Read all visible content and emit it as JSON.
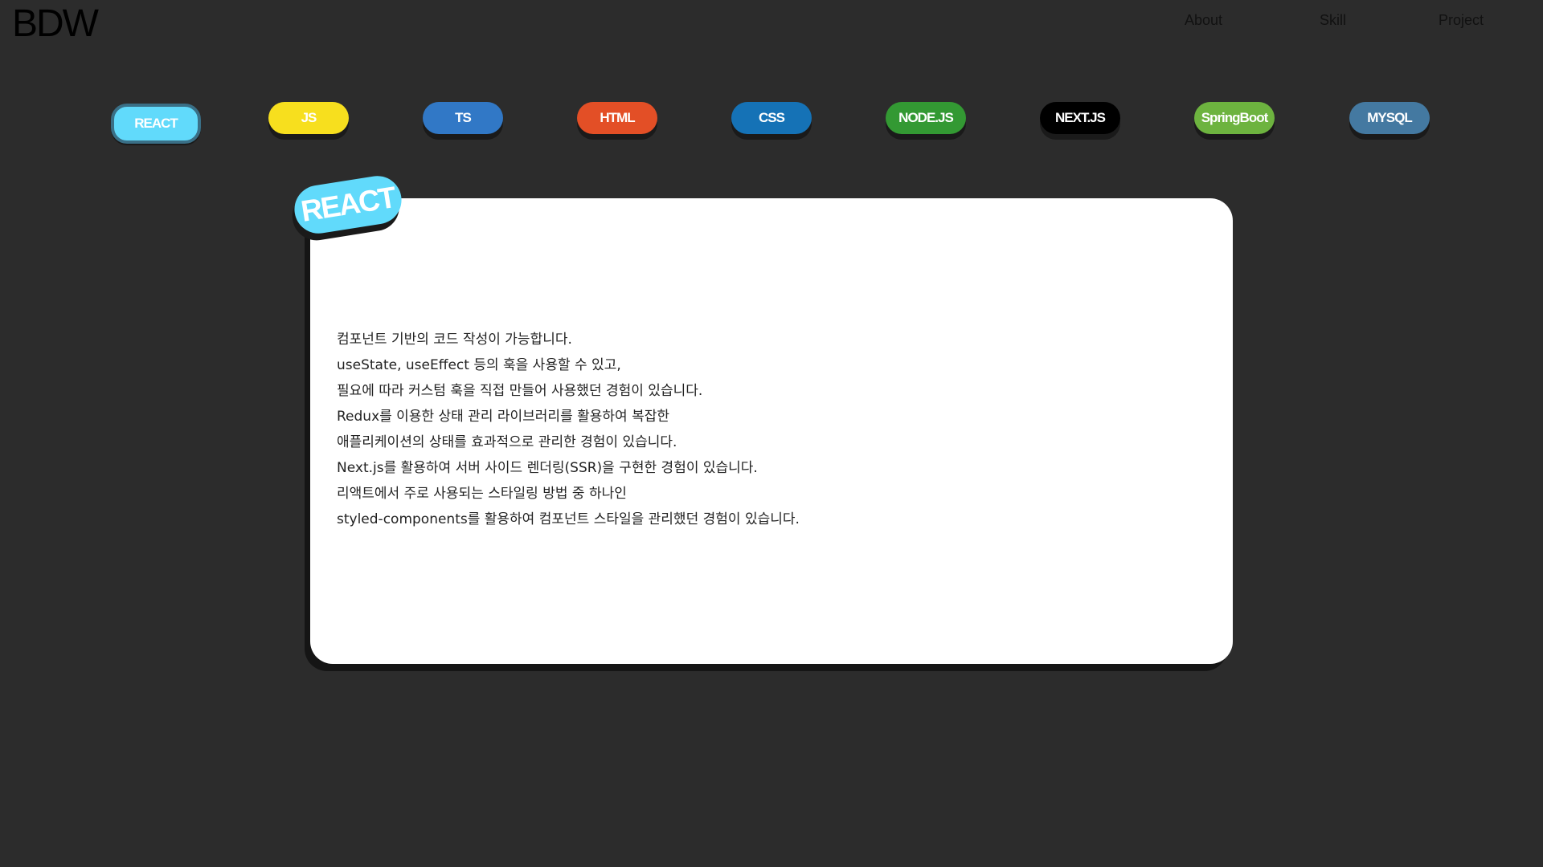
{
  "header": {
    "logo": "BDW",
    "nav": [
      {
        "label": "About"
      },
      {
        "label": "Skill"
      },
      {
        "label": "Project"
      }
    ]
  },
  "skills": [
    {
      "label": "REACT",
      "color": "#61dafb",
      "active": true
    },
    {
      "label": "JS",
      "color": "#f7df1e"
    },
    {
      "label": "TS",
      "color": "#3178c6"
    },
    {
      "label": "HTML",
      "color": "#e34f26"
    },
    {
      "label": "CSS",
      "color": "#1572b6"
    },
    {
      "label": "NODE.JS",
      "color": "#339933"
    },
    {
      "label": "NEXT.JS",
      "color": "#000000"
    },
    {
      "label": "SpringBoot",
      "color": "#6db33f"
    },
    {
      "label": "MYSQL",
      "color": "#4479a1"
    }
  ],
  "detail": {
    "badge": "REACT",
    "badge_color": "#61dafb",
    "lines": [
      "컴포넌트 기반의 코드 작성이 가능합니다.",
      "useState, useEffect 등의 훅을 사용할 수 있고,",
      "필요에 따라 커스텀 훅을 직접 만들어 사용했던 경험이 있습니다.",
      "Redux를 이용한 상태 관리 라이브러리를 활용하여 복잡한",
      "애플리케이션의 상태를 효과적으로 관리한 경험이 있습니다.",
      "Next.js를 활용하여 서버 사이드 렌더링(SSR)을 구현한 경험이 있습니다.",
      "리액트에서 주로 사용되는 스타일링 방법 중 하나인",
      "styled-components를 활용하여 컴포넌트 스타일을 관리했던 경험이 있습니다."
    ]
  }
}
